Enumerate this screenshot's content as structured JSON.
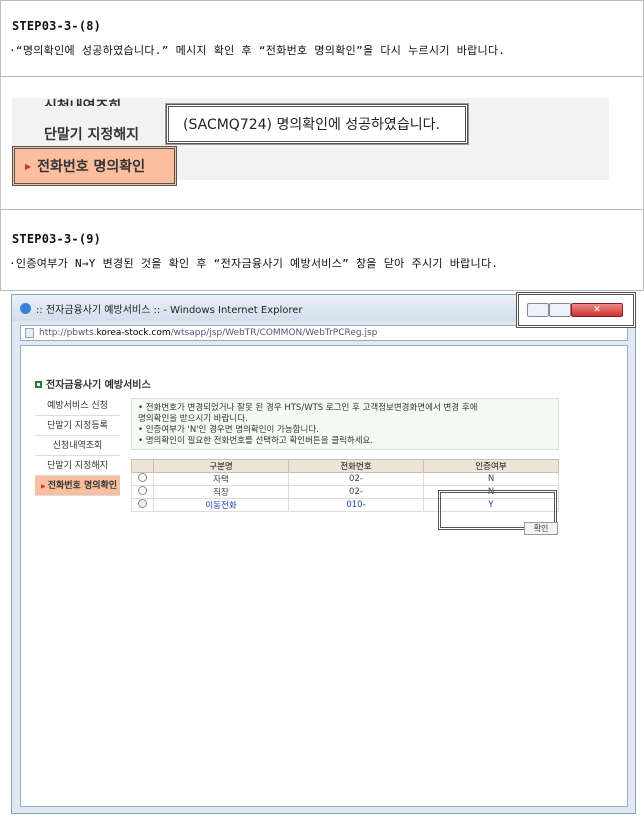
{
  "step1": {
    "title": "STEP03-3-(8)",
    "desc": "·“명의확인에 성공하였습니다.” 메시지 확인 후 “전화번호 명의확인”을 다시 누르시기 바랍니다."
  },
  "shot1": {
    "menu_top_partial": "신청내역조회",
    "menu_item": "단말기 지정해지",
    "popup_message": "(SACMQ724) 명의확인에 성공하였습니다.",
    "active_menu": "전화번호 명의확인"
  },
  "step2": {
    "title": "STEP03-3-(9)",
    "desc": "·인증여부가 N→Y 변경된 것을 확인 후 “전자금융사기 예방서비스” 창을 닫아 주시기 바랍니다."
  },
  "window": {
    "title": ":: 전자금융사기 예방서비스 :: - Windows Internet Explorer",
    "url_prefix": "http://pbwts.",
    "url_domain": "korea-stock.com",
    "url_path": "/wtsapp/jsp/WebTR/COMMON/WebTrPCReg.jsp",
    "section_title": "전자금융사기 예방서비스",
    "sidebar": [
      "예방서비스 신청",
      "단말기 지정등록",
      "신청내역조회",
      "단말기 지정해지",
      "전화번호 명의확인"
    ],
    "notice": [
      "• 전화번호가 변경되었거나 잘못 된 경우 HTS/WTS 로그인 후 고객정보변경화면에서 변경 후에",
      "   명의확인을 받으시기 바랍니다.",
      "• 인증여부가 'N'인 경우면 명의확인이 가능합니다.",
      "• 명의확인이 필요한 전화번호를 선택하고 확인버튼을 클릭하세요."
    ],
    "table_headers": [
      "구분명",
      "전화번호",
      "인증여부"
    ],
    "rows": [
      {
        "type": "자택",
        "phone": "02-",
        "verified": "N"
      },
      {
        "type": "직장",
        "phone": "02-",
        "verified": "N"
      },
      {
        "type": "이동전화",
        "phone": "010-",
        "verified": "Y"
      }
    ],
    "confirm_button": "확인"
  },
  "colors": {
    "active_menu_bg": "#fbbf9f",
    "table_header_bg": "#ede3d6",
    "mobile_row_text": "#1a3fb8"
  }
}
